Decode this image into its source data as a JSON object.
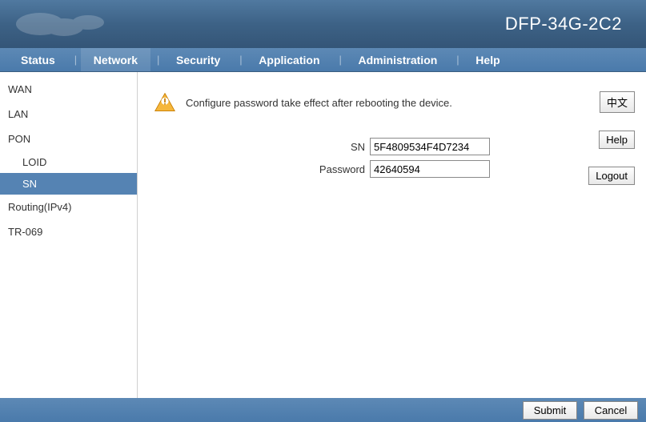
{
  "device_title": "DFP-34G-2C2",
  "nav": {
    "status": "Status",
    "network": "Network",
    "security": "Security",
    "application": "Application",
    "administration": "Administration",
    "help": "Help"
  },
  "sidebar": {
    "wan": "WAN",
    "lan": "LAN",
    "pon": "PON",
    "loid": "LOID",
    "sn": "SN",
    "routing": "Routing(IPv4)",
    "tr069": "TR-069"
  },
  "content": {
    "warning_text": "Configure password take effect after rebooting the device.",
    "sn_label": "SN",
    "sn_value": "5F4809534F4D7234",
    "password_label": "Password",
    "password_value": "42640594",
    "lang_btn": "中文",
    "help_btn": "Help",
    "logout_btn": "Logout"
  },
  "footer": {
    "submit": "Submit",
    "cancel": "Cancel"
  }
}
